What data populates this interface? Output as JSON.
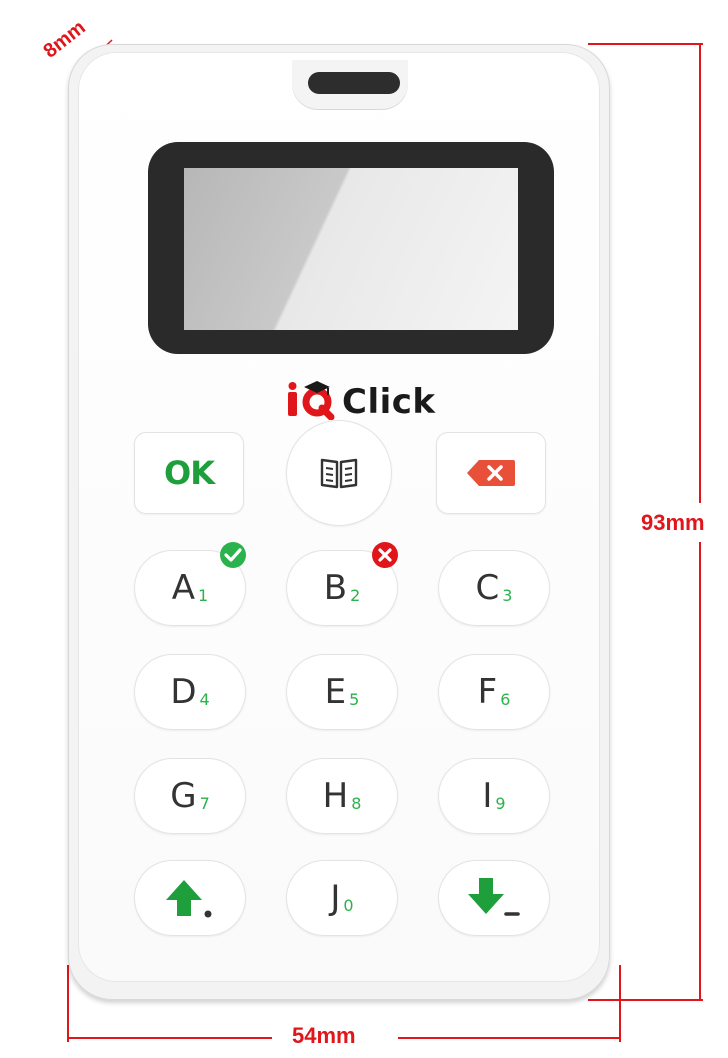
{
  "dimensions": {
    "height": "93mm",
    "width": "54mm",
    "thickness": "8mm"
  },
  "colors": {
    "dimension": "#e0161b",
    "accent_green": "#2bb24c",
    "ok_green": "#1e9f3c",
    "delete_red": "#e8503a",
    "wrong_red": "#e0161b"
  },
  "logo": {
    "text": "Click",
    "icon": "iq-logo-icon"
  },
  "keys": {
    "ok": "OK",
    "book_icon": "book-icon",
    "delete_icon": "backspace-icon",
    "A": {
      "letter": "A",
      "digit": "1"
    },
    "B": {
      "letter": "B",
      "digit": "2"
    },
    "C": {
      "letter": "C",
      "digit": "3"
    },
    "D": {
      "letter": "D",
      "digit": "4"
    },
    "E": {
      "letter": "E",
      "digit": "5"
    },
    "F": {
      "letter": "F",
      "digit": "6"
    },
    "G": {
      "letter": "G",
      "digit": "7"
    },
    "H": {
      "letter": "H",
      "digit": "8"
    },
    "I": {
      "letter": "I",
      "digit": "9"
    },
    "J": {
      "letter": "J",
      "digit": "0"
    },
    "up_icon": "arrow-up-icon",
    "down_icon": "arrow-down-icon"
  },
  "badges": {
    "correct_icon": "check-circle-icon",
    "wrong_icon": "x-circle-icon"
  }
}
